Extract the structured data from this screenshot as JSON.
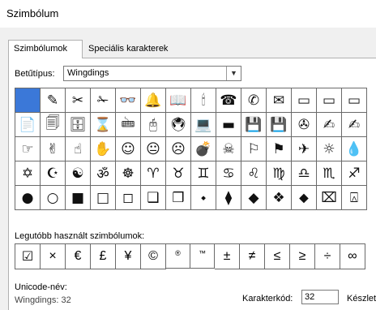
{
  "window": {
    "title": "Szimbólum"
  },
  "tabs": [
    {
      "label": "Szimbólumok"
    },
    {
      "label": "Speciális karakterek"
    }
  ],
  "font": {
    "label": "Betűtípus:",
    "value": "Wingdings"
  },
  "symbol_grid": [
    [
      "",
      "✎",
      "✂",
      "✁",
      "👓",
      "🔔",
      "📖",
      "🕯",
      "☎",
      "✆",
      "✉",
      "▭",
      "▭",
      "▭"
    ],
    [
      "📄",
      "🗐",
      "🗄",
      "⌛",
      "🖮",
      "🖰",
      "🖲",
      "💻",
      "▬",
      "💾",
      "💾",
      "✇",
      "✍",
      "✍"
    ],
    [
      "☞",
      "✌",
      "☝",
      "✋",
      "☺",
      "😐",
      "☹",
      "💣",
      "☠",
      "⚐",
      "⚑",
      "✈",
      "☼",
      "💧"
    ],
    [
      "✡",
      "☪",
      "☯",
      "ॐ",
      "☸",
      "♈",
      "♉",
      "♊",
      "♋",
      "♌",
      "♍",
      "♎",
      "♏",
      "♐"
    ],
    [
      "●",
      "○",
      "■",
      "□",
      "◻",
      "❑",
      "❒",
      "⬩",
      "⧫",
      "◆",
      "❖",
      "⬥",
      "⌧",
      "⍓"
    ]
  ],
  "recent": {
    "label": "Legutóbb használt szimbólumok:",
    "symbols": [
      "☑",
      "×",
      "€",
      "£",
      "¥",
      "©",
      "®",
      "™",
      "±",
      "≠",
      "≤",
      "≥",
      "÷",
      "∞"
    ]
  },
  "unicode": {
    "label": "Unicode-név:",
    "value": "Wingdings: 32"
  },
  "char_code": {
    "label": "Karakterkód:",
    "value": "32"
  },
  "charset": {
    "label": "Készlet"
  }
}
